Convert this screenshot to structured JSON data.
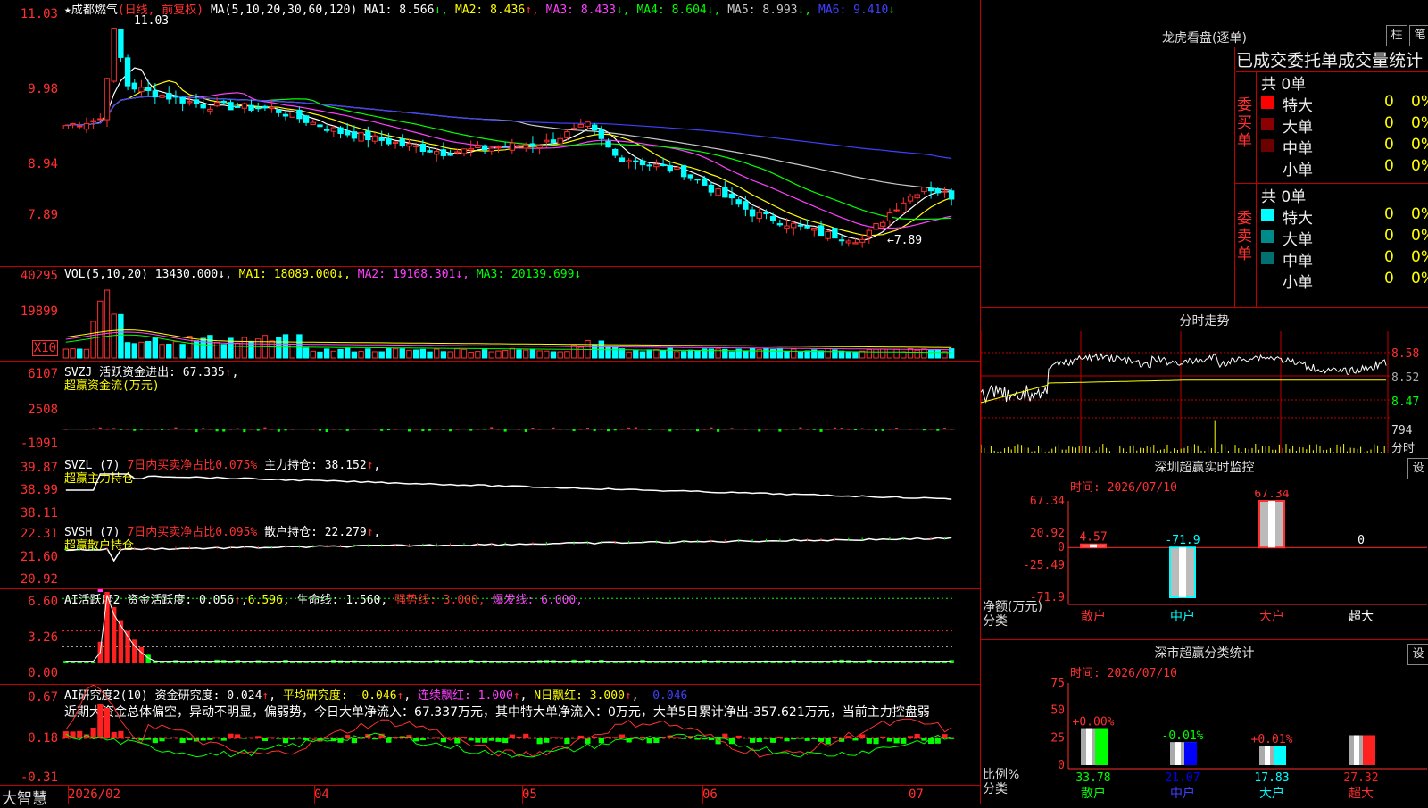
{
  "main": {
    "stock_name": "★成都燃气",
    "period_note": "(日线, 前复权)",
    "ma_label": "MA(5,10,20,30,60,120)",
    "ma": [
      {
        "label": "MA1: ",
        "value": "8.566",
        "arrow": "↓",
        "color": "#ffffff"
      },
      {
        "label": "MA2: ",
        "value": "8.436",
        "arrow": "↑",
        "color": "#ffff00"
      },
      {
        "label": "MA3: ",
        "value": "8.433",
        "arrow": "↓",
        "color": "#ff40ff"
      },
      {
        "label": "MA4: ",
        "value": "8.604",
        "arrow": "↓",
        "color": "#00ff00"
      },
      {
        "label": "MA5: ",
        "value": "8.993",
        "arrow": "↓",
        "color": "#c8c8c8"
      },
      {
        "label": "MA6: ",
        "value": "9.410",
        "arrow": "↓",
        "color": "#4040ff"
      }
    ],
    "y_ticks": [
      "11.03",
      "9.98",
      "8.94",
      "7.89"
    ],
    "high_label": "11.03",
    "low_label": "←7.89"
  },
  "vol": {
    "label": "VOL(5,10,20)",
    "value": "13430.000",
    "ma1": "18089.000",
    "ma2": "19168.301",
    "ma3": "20139.699",
    "y_ticks": [
      "40295",
      "19899"
    ],
    "unit": "X10"
  },
  "svzj": {
    "label": "SVZJ",
    "desc": "活跃资金进出: 67.335",
    "title": "超赢资金流(万元)",
    "y_ticks": [
      "6107",
      "2508",
      "-1091"
    ]
  },
  "svzl": {
    "label": "SVZL (7)",
    "ratio": "7日内买卖净占比0.075%",
    "main_pos": "主力持仓: 38.152",
    "title": "超赢主力持仓",
    "y_ticks": [
      "39.87",
      "38.99",
      "38.11"
    ]
  },
  "svsh": {
    "label": "SVSH (7)",
    "ratio": "7日内买卖净占比0.095%",
    "retail_pos": "散户持仓: 22.279",
    "title": "超赢散户持仓",
    "y_ticks": [
      "22.31",
      "21.60",
      "20.92"
    ]
  },
  "ai1": {
    "label": "AI活跃度2",
    "activity": "资金活跃度: 0.056",
    "v2": "6.596,",
    "life": "生命线: 1.560,",
    "strong": "强势线: 3.000,",
    "burst": "爆发线: 6.000,",
    "y_ticks": [
      "6.60",
      "3.26",
      "0.00"
    ]
  },
  "ai2": {
    "label": "AI研究度2(10)",
    "research": "资金研究度: 0.024",
    "avg": "平均研究度: -0.046",
    "red": "连续飘红: 1.000",
    "nred": "N日飘红: 3.000",
    "last": "-0.046",
    "comment": "近期大资金总体偏空，异动不明显，偏弱势，今日大单净流入：67.337万元，其中特大单净流入：0万元，大单5日累计净出-357.621万元，当前主力控盘弱",
    "y_ticks": [
      "0.67",
      "0.18",
      "-0.31"
    ]
  },
  "xaxis": {
    "brand": "大智慧",
    "labels": [
      "2026/02",
      "04",
      "05",
      "06",
      "07"
    ]
  },
  "orderbook": {
    "title": "龙虎看盘(逐单)",
    "btn1": "柱",
    "btn2": "笔",
    "header": "已成交委托单成交量统计",
    "buy_label": [
      "委",
      "买",
      "单"
    ],
    "sell_label": [
      "委",
      "卖",
      "单"
    ],
    "buy_total": "共 0单",
    "sell_total": "共 0单",
    "buy_rows": [
      {
        "name": "特大",
        "count": "0",
        "pct": "0%",
        "color": "#ff0000"
      },
      {
        "name": "大单",
        "count": "0",
        "pct": "0%",
        "color": "#8b0000"
      },
      {
        "name": "中单",
        "count": "0",
        "pct": "0%",
        "color": "#6b0000"
      },
      {
        "name": "小单",
        "count": "0",
        "pct": "0%",
        "color": ""
      }
    ],
    "sell_rows": [
      {
        "name": "特大",
        "count": "0",
        "pct": "0%",
        "color": "#00ffff"
      },
      {
        "name": "大单",
        "count": "0",
        "pct": "0%",
        "color": "#008b8b"
      },
      {
        "name": "中单",
        "count": "0",
        "pct": "0%",
        "color": "#007070"
      },
      {
        "name": "小单",
        "count": "0",
        "pct": "0%",
        "color": ""
      }
    ]
  },
  "intraday": {
    "title": "分时走势",
    "prices": [
      "8.58",
      "8.52",
      "8.47"
    ],
    "vol": "794",
    "vol_unit": "分时"
  },
  "monitor": {
    "title": "深圳超赢实时监控",
    "settings": "设",
    "date": "时间: 2026/07/10",
    "y_ticks": [
      "67.34",
      "20.92",
      "0",
      "-25.49",
      "-71.9"
    ],
    "axis_label": "净额(万元)",
    "axis_label2": "分类",
    "bars": [
      {
        "cat": "散户",
        "value": 4.57,
        "label": "4.57"
      },
      {
        "cat": "中户",
        "value": -71.9,
        "label": "-71.9"
      },
      {
        "cat": "大户",
        "value": 67.34,
        "label": "67.34"
      },
      {
        "cat": "超大",
        "value": 0,
        "label": "0"
      }
    ]
  },
  "classstats": {
    "title": "深市超赢分类统计",
    "settings": "设",
    "date": "时间: 2026/07/10",
    "y_ticks": [
      "75",
      "50",
      "25",
      "0"
    ],
    "axis_label": "比例%",
    "axis_label2": "分类",
    "bars": [
      {
        "cat": "散户",
        "value": 33.78,
        "change": "+0.00%",
        "color": "#00ff00"
      },
      {
        "cat": "中户",
        "value": 21.07,
        "change": "-0.01%",
        "color": "#0000ff"
      },
      {
        "cat": "大户",
        "value": 17.83,
        "change": "+0.01%",
        "color": "#00ffff"
      },
      {
        "cat": "超大",
        "value": 27.32,
        "change": "",
        "color": "#ff2020"
      }
    ],
    "values": [
      "33.78",
      "21.07",
      "17.83",
      "27.32"
    ]
  }
}
